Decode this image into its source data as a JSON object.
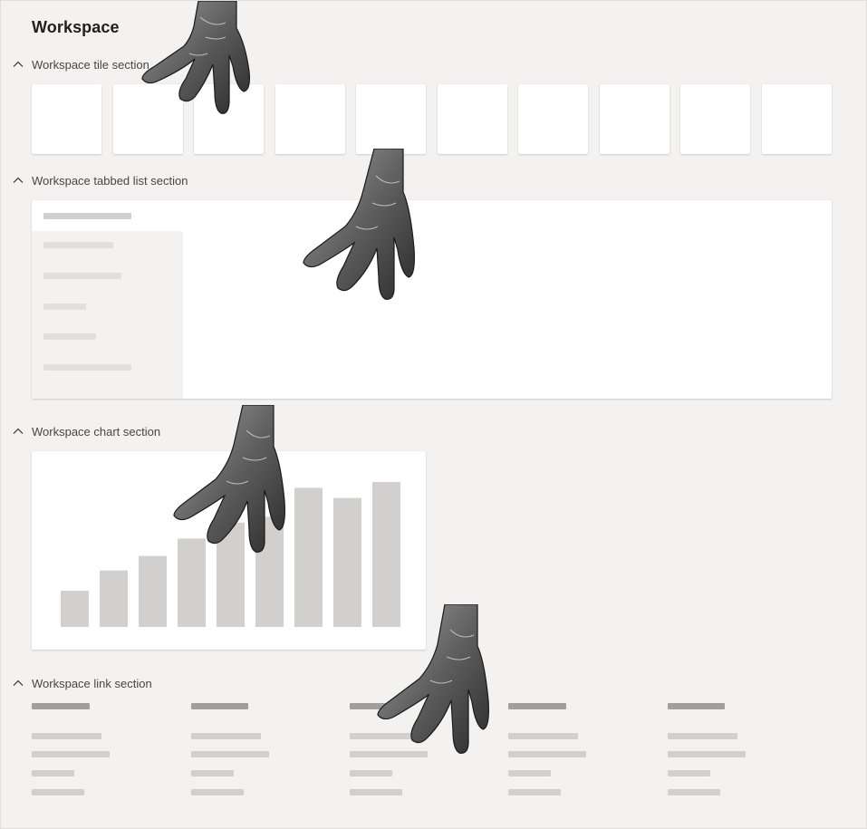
{
  "page": {
    "title": "Workspace"
  },
  "sections": {
    "tiles": {
      "label": "Workspace tile section",
      "tile_count": 10
    },
    "tabbed_list": {
      "label": "Workspace tabbed list section",
      "tab_placeholders": 5
    },
    "chart": {
      "label": "Workspace chart section"
    },
    "links": {
      "label": "Workspace link section",
      "column_count": 5,
      "lines_per_column": 4
    }
  },
  "chart_data": {
    "type": "bar",
    "categories": [
      "",
      "",
      "",
      "",
      "",
      "",
      "",
      "",
      ""
    ],
    "values": [
      25,
      39,
      49,
      61,
      72,
      76,
      96,
      89,
      100
    ],
    "title": "",
    "xlabel": "",
    "ylabel": "",
    "ylim": [
      0,
      100
    ],
    "grid": false,
    "colors": {
      "bar": "#d2d0ce"
    }
  },
  "colors": {
    "background": "#f3f2f1",
    "card": "#ffffff",
    "placeholder_light": "#e1dfdd",
    "placeholder_mid": "#d2d0ce",
    "placeholder_dark": "#a19f9d"
  },
  "icons": {
    "section_toggle": "chevron-up-icon",
    "overlay": "hand-overlay"
  }
}
